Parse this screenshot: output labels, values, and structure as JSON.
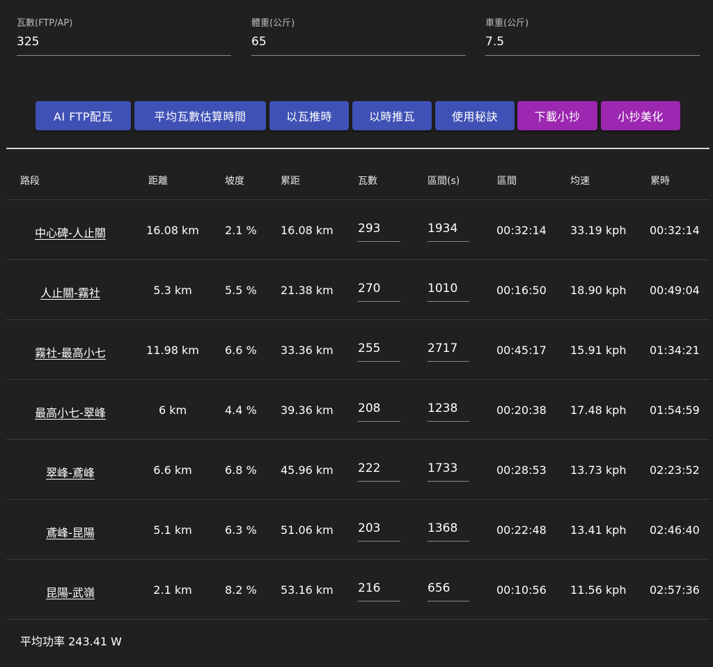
{
  "inputs": {
    "ftp": {
      "label": "瓦數(FTP/AP)",
      "value": "325"
    },
    "weight": {
      "label": "體重(公斤)",
      "value": "65"
    },
    "bike": {
      "label": "車重(公斤)",
      "value": "7.5"
    }
  },
  "buttons": {
    "ai_ftp": "AI FTP配瓦",
    "avg_estimate": "平均瓦數估算時間",
    "watt_to_time": "以瓦推時",
    "time_to_watt": "以時推瓦",
    "tips": "使用秘訣",
    "download": "下載小抄",
    "beautify": "小抄美化"
  },
  "colors": {
    "primary": "#3f51b5",
    "secondary": "#9c27b0",
    "background": "#202020"
  },
  "table": {
    "headers": [
      "路段",
      "距離",
      "坡度",
      "累距",
      "瓦數",
      "區間(s)",
      "區間",
      "均速",
      "累時"
    ],
    "rows": [
      {
        "segment": "中心碑-人止關",
        "distance": "16.08 km",
        "grade": "2.1 %",
        "cum_distance": "16.08 km",
        "watts": "293",
        "seconds": "1934",
        "interval": "00:32:14",
        "speed": "33.19 kph",
        "cum_time": "00:32:14"
      },
      {
        "segment": "人止關-霧社",
        "distance": "5.3 km",
        "grade": "5.5 %",
        "cum_distance": "21.38 km",
        "watts": "270",
        "seconds": "1010",
        "interval": "00:16:50",
        "speed": "18.90 kph",
        "cum_time": "00:49:04"
      },
      {
        "segment": "霧社-最高小七",
        "distance": "11.98 km",
        "grade": "6.6 %",
        "cum_distance": "33.36 km",
        "watts": "255",
        "seconds": "2717",
        "interval": "00:45:17",
        "speed": "15.91 kph",
        "cum_time": "01:34:21"
      },
      {
        "segment": "最高小七-翠峰",
        "distance": "6 km",
        "grade": "4.4 %",
        "cum_distance": "39.36 km",
        "watts": "208",
        "seconds": "1238",
        "interval": "00:20:38",
        "speed": "17.48 kph",
        "cum_time": "01:54:59"
      },
      {
        "segment": "翠峰-鳶峰",
        "distance": "6.6 km",
        "grade": "6.8 %",
        "cum_distance": "45.96 km",
        "watts": "222",
        "seconds": "1733",
        "interval": "00:28:53",
        "speed": "13.73 kph",
        "cum_time": "02:23:52"
      },
      {
        "segment": "鳶峰-昆陽",
        "distance": "5.1 km",
        "grade": "6.3 %",
        "cum_distance": "51.06 km",
        "watts": "203",
        "seconds": "1368",
        "interval": "00:22:48",
        "speed": "13.41 kph",
        "cum_time": "02:46:40"
      },
      {
        "segment": "昆陽-武嶺",
        "distance": "2.1 km",
        "grade": "8.2 %",
        "cum_distance": "53.16 km",
        "watts": "216",
        "seconds": "656",
        "interval": "00:10:56",
        "speed": "11.56 kph",
        "cum_time": "02:57:36"
      }
    ]
  },
  "footer": {
    "avg_power": "平均功率 243.41 W"
  }
}
